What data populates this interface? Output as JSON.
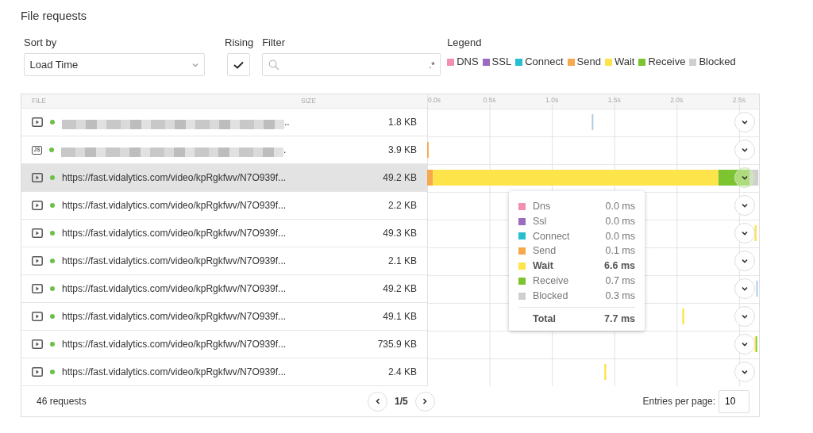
{
  "title": "File requests",
  "controls": {
    "sort_label": "Sort by",
    "sort_value": "Load Time",
    "rising_label": "Rising",
    "rising_checked": true,
    "filter_label": "Filter",
    "filter_regex": ".*",
    "legend_label": "Legend"
  },
  "table": {
    "columns": [
      "FILE",
      "SIZE"
    ],
    "rows": [
      {
        "kind": "video",
        "redacted": true,
        "file_tail": "..",
        "size": "1.8 KB",
        "selected": false
      },
      {
        "kind": "script",
        "type_label": "JS",
        "redacted": true,
        "file_tail": ".",
        "size": "3.9 KB",
        "selected": false
      },
      {
        "kind": "video",
        "file": "https://fast.vidalytics.com/video/kpRgkfwv/N7O939f...",
        "size": "49.2 KB",
        "selected": true
      },
      {
        "kind": "video",
        "file": "https://fast.vidalytics.com/video/kpRgkfwv/N7O939f...",
        "size": "2.2 KB",
        "selected": false
      },
      {
        "kind": "video",
        "file": "https://fast.vidalytics.com/video/kpRgkfwv/N7O939f...",
        "size": "49.3 KB",
        "selected": false
      },
      {
        "kind": "video",
        "file": "https://fast.vidalytics.com/video/kpRgkfwv/N7O939f...",
        "size": "2.1 KB",
        "selected": false
      },
      {
        "kind": "video",
        "file": "https://fast.vidalytics.com/video/kpRgkfwv/N7O939f...",
        "size": "49.2 KB",
        "selected": false
      },
      {
        "kind": "video",
        "file": "https://fast.vidalytics.com/video/kpRgkfwv/N7O939f...",
        "size": "49.1 KB",
        "selected": false
      },
      {
        "kind": "video",
        "file": "https://fast.vidalytics.com/video/kpRgkfwv/N7O939f...",
        "size": "735.9 KB",
        "selected": false
      },
      {
        "kind": "video",
        "file": "https://fast.vidalytics.com/video/kpRgkfwv/N7O939f...",
        "size": "2.4 KB",
        "selected": false
      }
    ],
    "timeline_ticks": [
      "0.0s",
      "0.5s",
      "1.0s",
      "1.5s",
      "2.0s",
      "2.5s"
    ]
  },
  "legend": [
    {
      "label": "DNS",
      "color": "#f48fb1"
    },
    {
      "label": "SSL",
      "color": "#9b6bbf"
    },
    {
      "label": "Connect",
      "color": "#26bfd2"
    },
    {
      "label": "Send",
      "color": "#f5a94c"
    },
    {
      "label": "Wait",
      "color": "#fde44b"
    },
    {
      "label": "Receive",
      "color": "#7cc530"
    },
    {
      "label": "Blocked",
      "color": "#cfcfcf"
    }
  ],
  "tooltip": {
    "items": [
      {
        "label": "Dns",
        "value": "0.0 ms",
        "color": "#f48fb1",
        "emphasized": false
      },
      {
        "label": "Ssl",
        "value": "0.0 ms",
        "color": "#9b6bbf",
        "emphasized": false
      },
      {
        "label": "Connect",
        "value": "0.0 ms",
        "color": "#26bfd2",
        "emphasized": false
      },
      {
        "label": "Send",
        "value": "0.1 ms",
        "color": "#f5a94c",
        "emphasized": false
      },
      {
        "label": "Wait",
        "value": "6.6 ms",
        "color": "#fde44b",
        "emphasized": true
      },
      {
        "label": "Receive",
        "value": "0.7 ms",
        "color": "#7cc530",
        "emphasized": false
      },
      {
        "label": "Blocked",
        "value": "0.3 ms",
        "color": "#cfcfcf",
        "emphasized": false
      }
    ],
    "total_label": "Total",
    "total_value": "7.7 ms"
  },
  "footer": {
    "count": "46 requests",
    "page": "1/5",
    "entries_label": "Entries per page:",
    "entries_value": "10"
  }
}
